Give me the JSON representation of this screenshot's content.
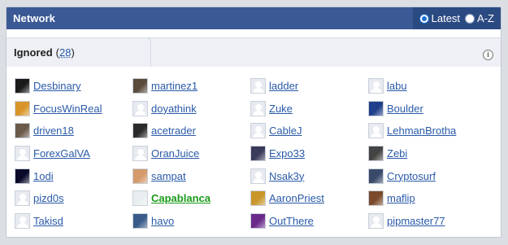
{
  "header": {
    "title": "Network",
    "sort": {
      "latest_label": "Latest",
      "az_label": "A-Z",
      "selected": "Latest"
    }
  },
  "tab": {
    "label": "Ignored",
    "open_paren": "(",
    "count": "28",
    "close_paren": ")"
  },
  "info_icon": "i",
  "users": [
    {
      "name": "Desbinary",
      "avatar": "photo",
      "color": "#1b1b1b"
    },
    {
      "name": "martinez1",
      "avatar": "photo",
      "color": "#5a4a3a"
    },
    {
      "name": "ladder",
      "avatar": "default"
    },
    {
      "name": "labu",
      "avatar": "default"
    },
    {
      "name": "FocusWinReal",
      "avatar": "photo",
      "color": "#d8962a"
    },
    {
      "name": "doyathink",
      "avatar": "default"
    },
    {
      "name": "Zuke",
      "avatar": "default"
    },
    {
      "name": "Boulder",
      "avatar": "photo",
      "color": "#1f3f8a"
    },
    {
      "name": "driven18",
      "avatar": "photo",
      "color": "#6b5a4a"
    },
    {
      "name": "acetrader",
      "avatar": "photo",
      "color": "#2a2a2a"
    },
    {
      "name": "CableJ",
      "avatar": "default"
    },
    {
      "name": "LehmanBrotha",
      "avatar": "default"
    },
    {
      "name": "ForexGalVA",
      "avatar": "default"
    },
    {
      "name": "OranJuice",
      "avatar": "default"
    },
    {
      "name": "Expo33",
      "avatar": "photo",
      "color": "#3a3a5a"
    },
    {
      "name": "Zebi",
      "avatar": "photo",
      "color": "#444444"
    },
    {
      "name": "1odi",
      "avatar": "photo",
      "color": "#0a0a2a"
    },
    {
      "name": "sampat",
      "avatar": "photo",
      "color": "#d49a6a"
    },
    {
      "name": "Nsak3y",
      "avatar": "default"
    },
    {
      "name": "Cryptosurf",
      "avatar": "photo",
      "color": "#3a4a6a"
    },
    {
      "name": "pizd0s",
      "avatar": "default"
    },
    {
      "name": "Capablanca",
      "avatar": "photo",
      "color": "#e8eef0",
      "highlight": true
    },
    {
      "name": "AaronPriest",
      "avatar": "photo",
      "color": "#c8962a"
    },
    {
      "name": "maflip",
      "avatar": "photo",
      "color": "#7a4a2a"
    },
    {
      "name": "Takisd",
      "avatar": "default"
    },
    {
      "name": "havo",
      "avatar": "photo",
      "color": "#3a5a8a"
    },
    {
      "name": "OutThere",
      "avatar": "photo",
      "color": "#6a2a8a"
    },
    {
      "name": "pipmaster77",
      "avatar": "default"
    }
  ],
  "colors": {
    "header_bg": "#3a5995",
    "link": "#2a5aa8",
    "highlight_link": "#1a9a1a",
    "page_bg": "#dbdee3"
  }
}
